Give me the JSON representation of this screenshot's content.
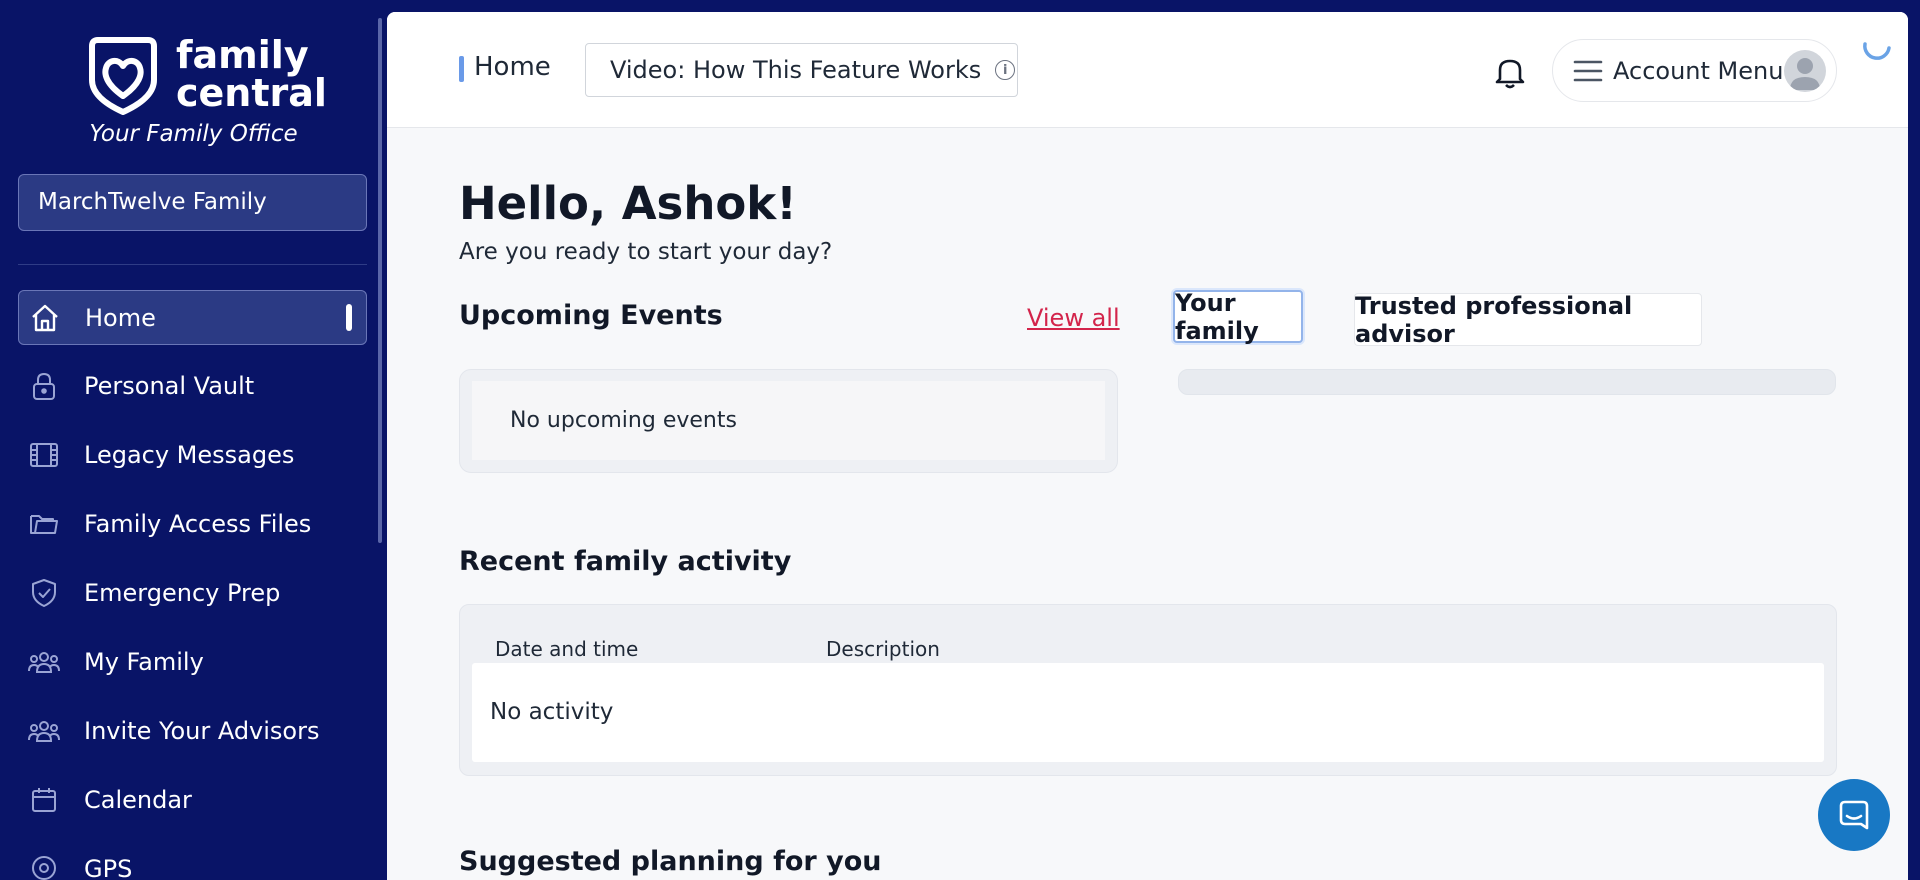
{
  "brand": {
    "logo_line1": "family",
    "logo_line2": "central",
    "tagline": "Your Family Office"
  },
  "sidebar": {
    "family_selector": "MarchTwelve Family",
    "items": [
      {
        "label": "Home",
        "icon": "home-icon",
        "active": true
      },
      {
        "label": "Personal Vault",
        "icon": "lock-icon"
      },
      {
        "label": "Legacy Messages",
        "icon": "film-icon"
      },
      {
        "label": "Family Access Files",
        "icon": "folder-icon"
      },
      {
        "label": "Emergency Prep",
        "icon": "shield-check-icon"
      },
      {
        "label": "My Family",
        "icon": "people-icon"
      },
      {
        "label": "Invite Your Advisors",
        "icon": "people-icon"
      },
      {
        "label": "Calendar",
        "icon": "calendar-icon"
      },
      {
        "label": "GPS",
        "icon": "location-icon"
      }
    ]
  },
  "header": {
    "breadcrumb": "Home",
    "video_button": "Video: How This Feature Works",
    "account_menu": "Account Menu"
  },
  "main": {
    "greeting": "Hello, Ashok!",
    "subgreeting": "Are you ready to start your day?",
    "upcoming_events": {
      "title": "Upcoming Events",
      "view_all": "View all",
      "empty": "No upcoming events"
    },
    "tabs": [
      {
        "label": "Your family",
        "active": true
      },
      {
        "label": "Trusted professional advisor",
        "active": false
      }
    ],
    "recent_activity": {
      "title": "Recent family activity",
      "columns": [
        "Date and time",
        "Description"
      ],
      "empty": "No activity"
    },
    "suggested_title": "Suggested planning for you"
  },
  "colors": {
    "sidebar_bg": "#091467",
    "accent_link": "#d3244b",
    "chat_button": "#1878c4"
  }
}
